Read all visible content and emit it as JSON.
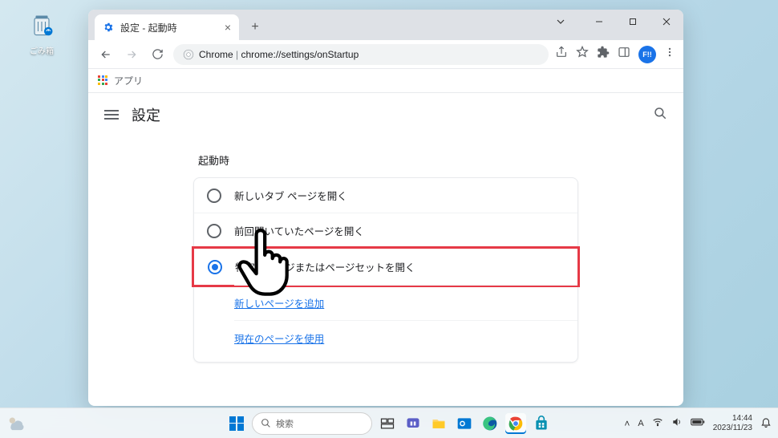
{
  "desktop": {
    "recycle_bin_label": "ごみ箱"
  },
  "browser": {
    "tab_title": "設定 - 起動時",
    "address": {
      "prefix": "Chrome",
      "url": "chrome://settings/onStartup"
    },
    "bookmarks": {
      "apps_label": "アプリ"
    },
    "avatar_text": "F!!"
  },
  "settings": {
    "page_title": "設定",
    "section_title": "起動時",
    "options": [
      {
        "label": "新しいタブ ページを開く",
        "checked": false
      },
      {
        "label": "前回開いていたページを開く",
        "checked": false
      },
      {
        "label": "特定のページまたはページセットを開く",
        "checked": true
      }
    ],
    "sub_links": [
      "新しいページを追加",
      "現在のページを使用"
    ]
  },
  "taskbar": {
    "search_placeholder": "検索",
    "ime": "A",
    "time": "14:44",
    "date": "2023/11/23"
  }
}
